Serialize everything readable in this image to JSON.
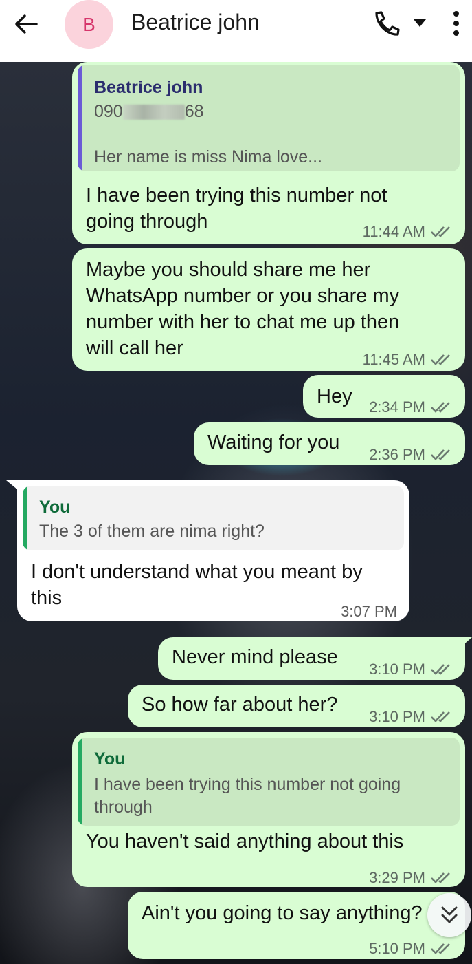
{
  "header": {
    "avatar_letter": "B",
    "contact_name": "Beatrice john"
  },
  "messages": [
    {
      "dir": "out",
      "quote": {
        "author": "Beatrice john",
        "line1_prefix": "090",
        "line1_suffix": "68",
        "line2": "Her name is miss Nima love..."
      },
      "lines": [
        "I have been trying this number not",
        "going through"
      ],
      "time": "11:44 AM"
    },
    {
      "dir": "out",
      "lines": [
        "Maybe you should share me her",
        "WhatsApp number or you share my",
        "number with her to chat me up then",
        "will call her"
      ],
      "time": "11:45 AM"
    },
    {
      "dir": "out",
      "lines": [
        "Hey"
      ],
      "time": "2:34 PM"
    },
    {
      "dir": "out",
      "lines": [
        "Waiting for you"
      ],
      "time": "2:36 PM"
    },
    {
      "dir": "in",
      "quote": {
        "author": "You",
        "line1": "The 3 of them are nima right?"
      },
      "lines": [
        "I don't understand what you meant by",
        "this"
      ],
      "time": "3:07 PM"
    },
    {
      "dir": "out",
      "lines": [
        "Never mind please"
      ],
      "time": "3:10 PM"
    },
    {
      "dir": "out",
      "lines": [
        "So how far about her?"
      ],
      "time": "3:10 PM"
    },
    {
      "dir": "out",
      "quote": {
        "author": "You",
        "line1": "I have been trying this number not going",
        "line2": "through"
      },
      "lines": [
        "You haven't said anything about this"
      ],
      "time": "3:29 PM"
    },
    {
      "dir": "out",
      "lines": [
        "Ain't you going to say anything?"
      ],
      "time": "5:10 PM"
    }
  ],
  "colors": {
    "outgoing_bubble": "#d9fdd3",
    "incoming_bubble": "#ffffff",
    "quote_bar_contact": "#6b5bd6",
    "quote_bar_you": "#25a962",
    "quote_author_contact": "#2b2d6e",
    "quote_author_you": "#0f6b3a",
    "read_ticks": "#6b7a70"
  },
  "icons": {
    "back": "back-arrow-icon",
    "call": "phone-icon",
    "dropdown": "caret-down-icon",
    "more": "more-vert-icon",
    "ticks": "double-check-icon",
    "scroll": "double-chevron-down-icon"
  }
}
